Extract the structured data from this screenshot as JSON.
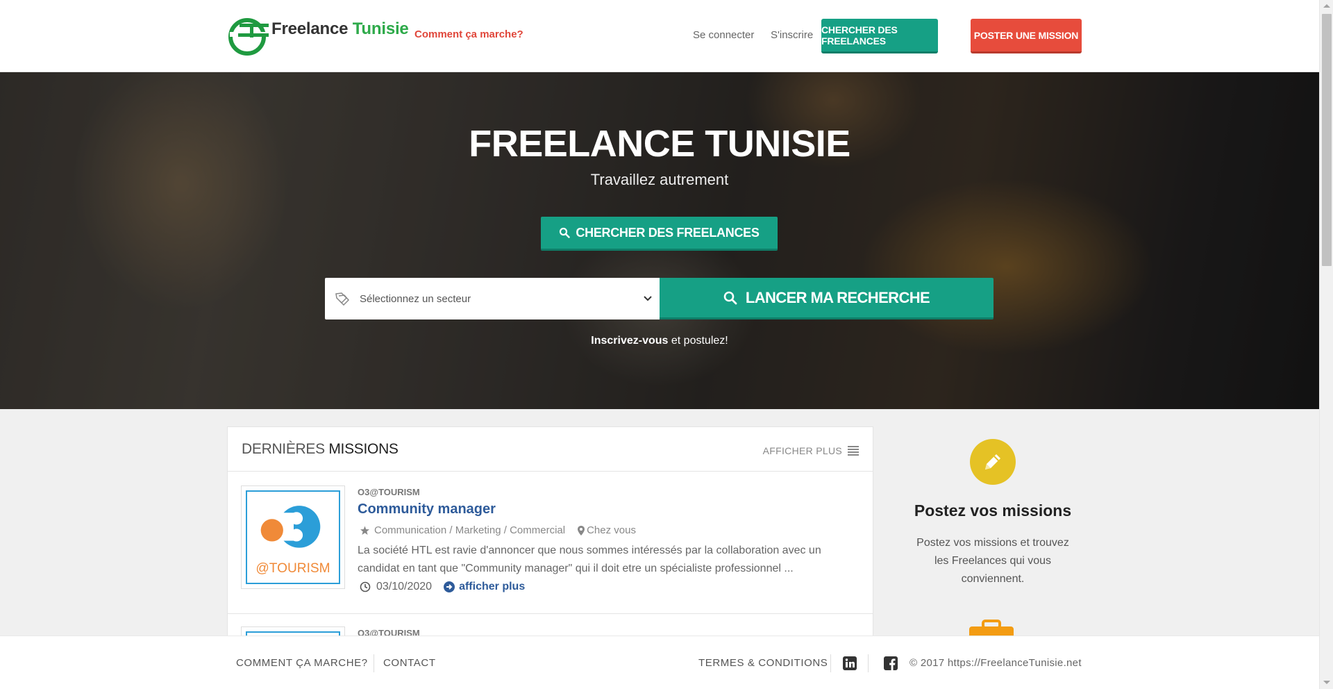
{
  "header": {
    "logo_text_dark": "Freelance",
    "logo_text_green": "Tunisie",
    "how_link": "Comment ça marche?",
    "login": "Se connecter",
    "register": "S'inscrire",
    "btn_find": "CHERCHER DES FREELANCES",
    "btn_post": "POSTER UNE MISSION"
  },
  "hero": {
    "title": "FREELANCE TUNISIE",
    "subtitle": "Travaillez autrement",
    "find_button": "CHERCHER DES FREELANCES",
    "select_placeholder": "Sélectionnez un secteur",
    "search_button": "LANCER MA RECHERCHE",
    "register_bold": "Inscrivez-vous",
    "register_rest": " et postulez!"
  },
  "missions": {
    "title_light": "DERNIÈRES ",
    "title_strong": "MISSIONS",
    "more": "AFFICHER PLUS",
    "items": [
      {
        "company": "O3@TOURISM",
        "title": "Community manager",
        "category": "Communication / Marketing / Commercial",
        "location": "Chez vous",
        "description": "La société HTL est ravie d'annoncer que nous sommes intéressés par la collaboration avec un candidat en tant que \"Community manager\" qui il doit etre un spécialiste professionnel ...",
        "date": "03/10/2020",
        "show_more": "afficher plus",
        "logo_text": "@TOURISM"
      },
      {
        "company": "O3@TOURISM"
      }
    ]
  },
  "sidebar": {
    "post_title": "Postez vos missions",
    "post_text": "Postez vos missions et trouvez les Freelances qui vous conviennent."
  },
  "footer": {
    "how": "COMMENT ÇA MARCHE?",
    "contact": "CONTACT",
    "terms": "TERMES & CONDITIONS",
    "copyright": "© 2017 https://FreelanceTunisie.net"
  },
  "colors": {
    "accent_green": "#16a085",
    "accent_red": "#e74c3c",
    "link_blue": "#2e5b9a",
    "logo_green": "#2eaa4a",
    "icon_yellow": "#e5c225"
  }
}
